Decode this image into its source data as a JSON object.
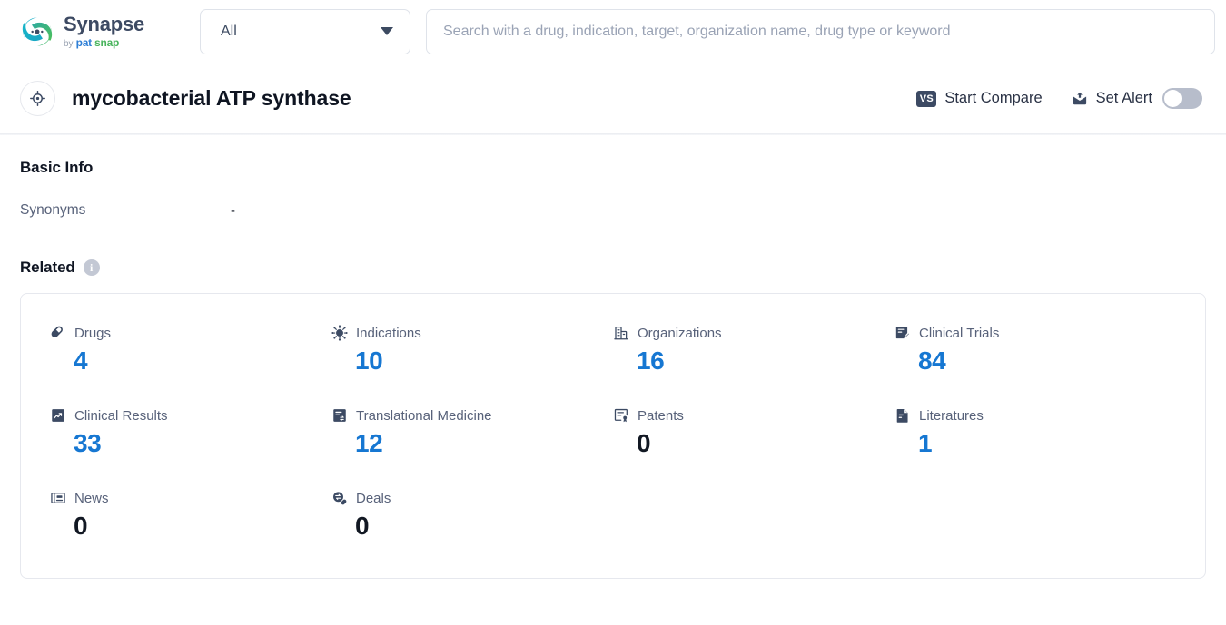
{
  "brand": {
    "name": "Synapse",
    "by": "by",
    "company_part1": "pat",
    "company_part2": "snap",
    "logo_icon": "synapse-swirl-logo"
  },
  "search": {
    "scope_value": "All",
    "scope_icon": "chevron-down-icon",
    "placeholder": "Search with a drug, indication, target, organization name, drug type or keyword",
    "input_value": ""
  },
  "header": {
    "entity_icon": "target-icon",
    "title": "mycobacterial ATP synthase",
    "compare": {
      "label": "Start Compare",
      "icon": "vs-icon",
      "badge_text": "VS"
    },
    "alert": {
      "label": "Set Alert",
      "icon": "mail-alert-icon",
      "toggle_on": false
    }
  },
  "basic_info": {
    "heading": "Basic Info",
    "rows": [
      {
        "label": "Synonyms",
        "value": "-"
      }
    ]
  },
  "related": {
    "heading": "Related",
    "info_icon": "info-icon",
    "info_glyph": "i",
    "stats": [
      {
        "label": "Drugs",
        "value": "4",
        "icon": "pill-icon",
        "is_zero": false
      },
      {
        "label": "Indications",
        "value": "10",
        "icon": "virus-icon",
        "is_zero": false
      },
      {
        "label": "Organizations",
        "value": "16",
        "icon": "building-icon",
        "is_zero": false
      },
      {
        "label": "Clinical Trials",
        "value": "84",
        "icon": "clinical-trial-icon",
        "is_zero": false
      },
      {
        "label": "Clinical Results",
        "value": "33",
        "icon": "clinical-result-icon",
        "is_zero": false
      },
      {
        "label": "Translational Medicine",
        "value": "12",
        "icon": "translational-icon",
        "is_zero": false
      },
      {
        "label": "Patents",
        "value": "0",
        "icon": "patent-icon",
        "is_zero": true
      },
      {
        "label": "Literatures",
        "value": "1",
        "icon": "literature-icon",
        "is_zero": false
      },
      {
        "label": "News",
        "value": "0",
        "icon": "news-icon",
        "is_zero": true
      },
      {
        "label": "Deals",
        "value": "0",
        "icon": "deals-icon",
        "is_zero": true
      }
    ]
  },
  "colors": {
    "link_blue": "#1677d2",
    "text_dark": "#0f1522",
    "text_muted": "#58627a",
    "border": "#e6e8ee",
    "toggle_off": "#b7bdcb"
  }
}
